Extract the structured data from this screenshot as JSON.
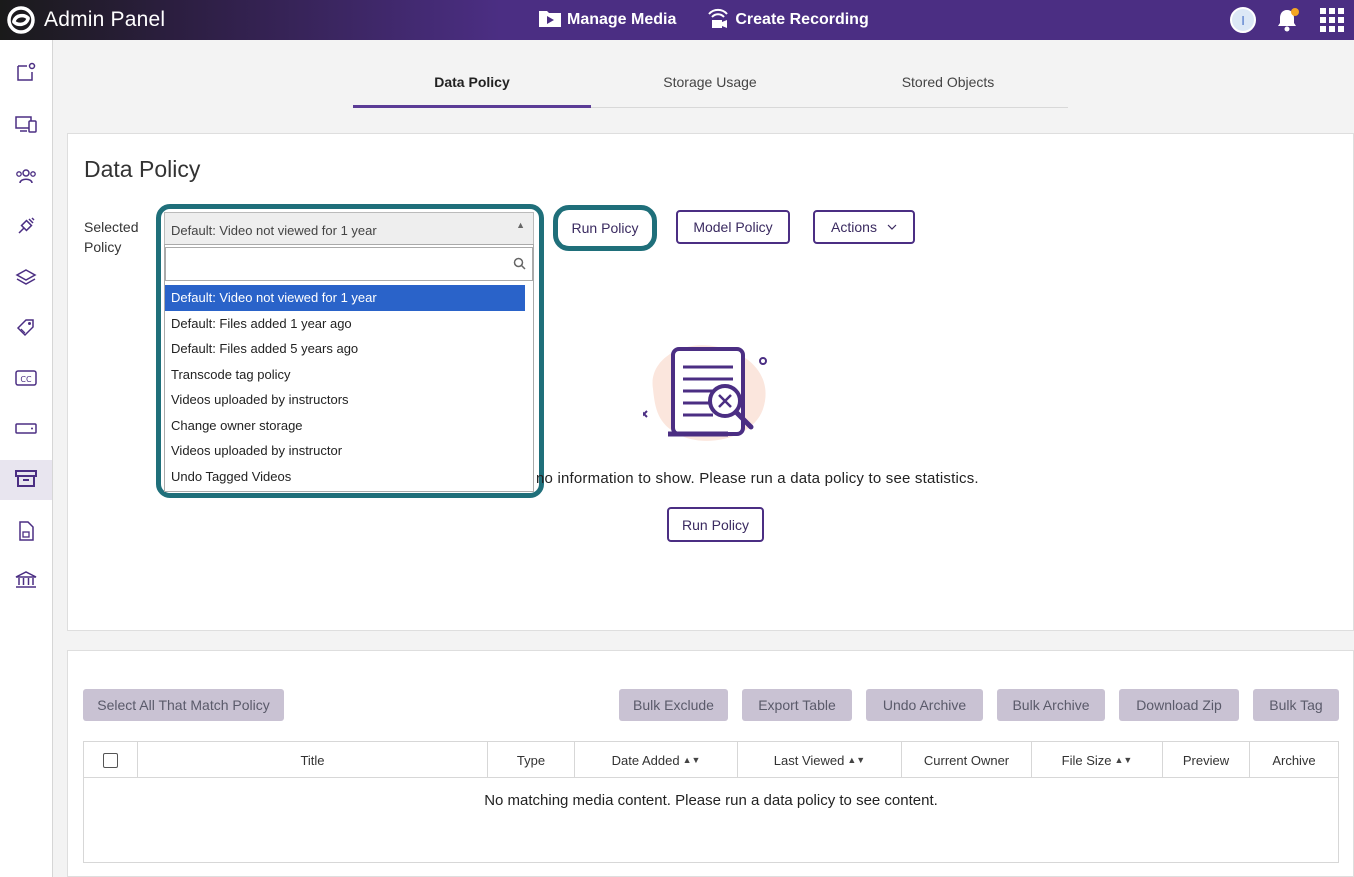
{
  "app": {
    "title": "Admin Panel"
  },
  "top_nav": {
    "manage_media": "Manage Media",
    "create_recording": "Create Recording"
  },
  "user": {
    "avatar_initial": "I"
  },
  "colors": {
    "brand_purple": "#4b2e83",
    "highlight_teal": "#1f6f7a",
    "selected_option": "#2a63c9",
    "notification_dot": "#f5a623"
  },
  "sidebar": {
    "items": [
      {
        "icon": "dashboard-icon"
      },
      {
        "icon": "devices-icon"
      },
      {
        "icon": "users-icon"
      },
      {
        "icon": "integrations-icon"
      },
      {
        "icon": "layers-icon"
      },
      {
        "icon": "tags-icon"
      },
      {
        "icon": "captions-icon"
      },
      {
        "icon": "storage-drive-icon"
      },
      {
        "icon": "archive-icon",
        "active": true
      },
      {
        "icon": "file-report-icon"
      },
      {
        "icon": "institution-icon"
      }
    ]
  },
  "tabs": [
    {
      "label": "Data Policy",
      "active": true
    },
    {
      "label": "Storage Usage"
    },
    {
      "label": "Stored Objects"
    }
  ],
  "policy": {
    "title": "Data Policy",
    "selected_label": "Selected Policy",
    "selected_value": "Default: Video not viewed for 1 year",
    "search_placeholder": "",
    "options": [
      "Default: Video not viewed for 1 year",
      "Default: Files added 1 year ago",
      "Default: Files added 5 years ago",
      "Transcode tag policy",
      "Videos uploaded by instructors",
      "Change owner storage",
      "Videos uploaded by instructor",
      "Undo Tagged Videos"
    ],
    "run_policy": "Run Policy",
    "model_policy": "Model Policy",
    "actions": "Actions",
    "empty_text": "no information to show. Please run a data policy to see statistics.",
    "empty_run": "Run Policy"
  },
  "table_actions": {
    "select_all": "Select All That Match Policy",
    "bulk_exclude": "Bulk Exclude",
    "export_table": "Export Table",
    "undo_archive": "Undo Archive",
    "bulk_archive": "Bulk Archive",
    "download_zip": "Download Zip",
    "bulk_tag": "Bulk Tag"
  },
  "table": {
    "columns": [
      "Title",
      "Type",
      "Date Added",
      "Last Viewed",
      "Current Owner",
      "File Size",
      "Preview",
      "Archive"
    ],
    "empty": "No matching media content. Please run a data policy to see content."
  }
}
